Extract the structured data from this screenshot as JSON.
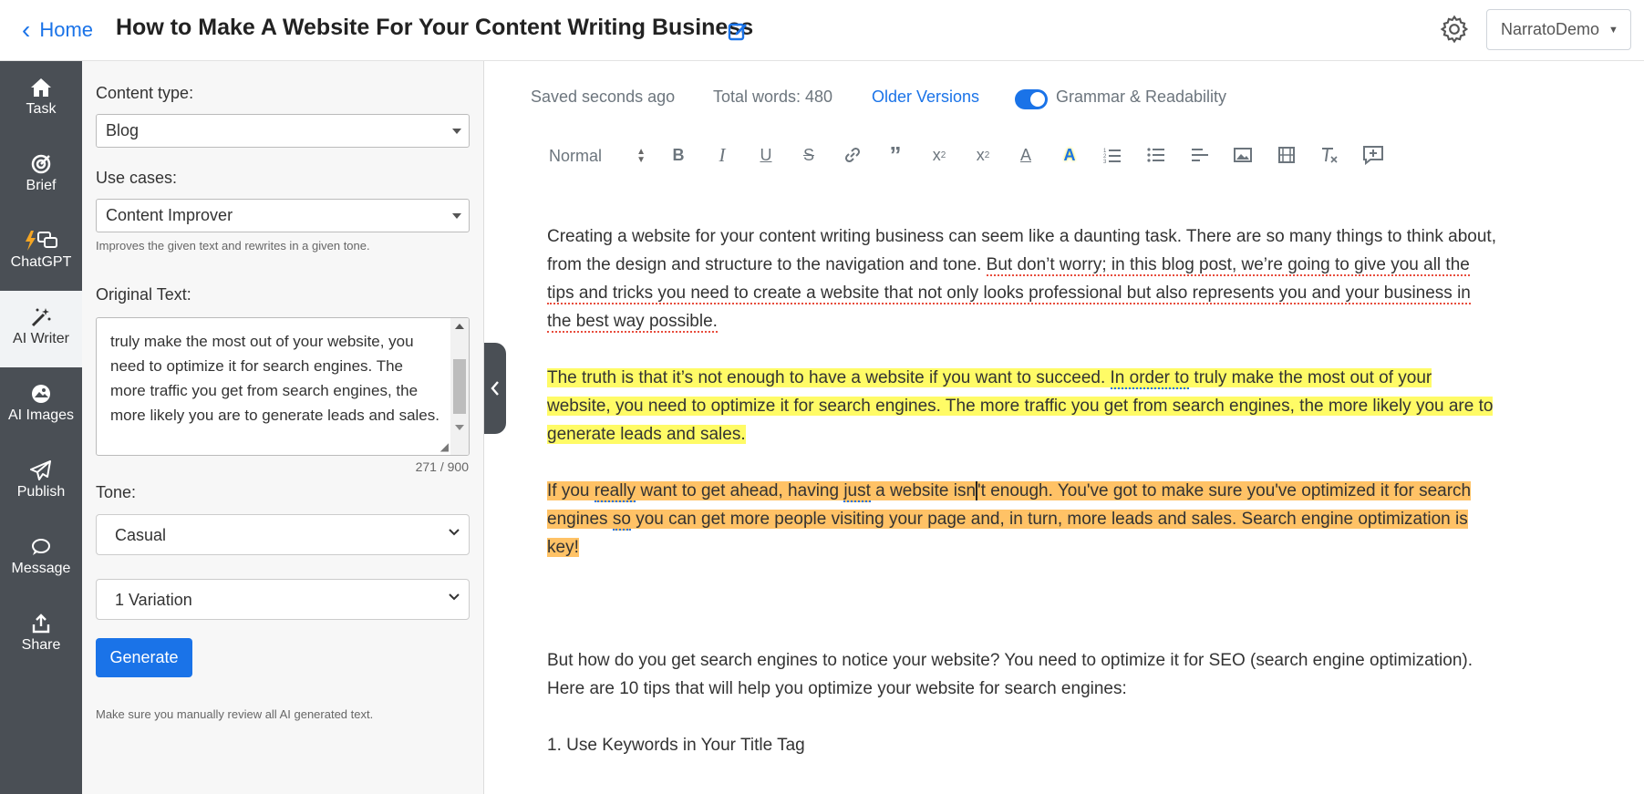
{
  "header": {
    "back_label": "Home",
    "title": "How to Make A Website For Your Content Writing Business",
    "user_menu": "NarratoDemo"
  },
  "rail": {
    "items": [
      {
        "label": "Task",
        "icon": "home-icon"
      },
      {
        "label": "Brief",
        "icon": "target-icon"
      },
      {
        "label": "ChatGPT",
        "icon": "chat-bolt-icon"
      },
      {
        "label": "AI Writer",
        "icon": "magic-wand-icon"
      },
      {
        "label": "AI Images",
        "icon": "image-icon"
      },
      {
        "label": "Publish",
        "icon": "send-icon"
      },
      {
        "label": "Message",
        "icon": "message-icon"
      },
      {
        "label": "Share",
        "icon": "share-icon"
      }
    ],
    "active": "AI Writer"
  },
  "panel": {
    "content_type_label": "Content type:",
    "content_type_value": "Blog",
    "use_cases_label": "Use cases:",
    "use_case_value": "Content Improver",
    "use_case_hint": "Improves the given text and rewrites in a given tone.",
    "original_text_label": "Original Text:",
    "original_text": "truly make the most out of your website, you need to optimize it for search engines. The more traffic you get from search engines, the more likely you are to generate leads and sales.",
    "char_count": "271 / 900",
    "tone_label": "Tone:",
    "tone_value": "Casual",
    "variation_value": "1 Variation",
    "generate_label": "Generate",
    "disclaimer": "Make sure you manually review all AI generated text."
  },
  "editor": {
    "saved_status": "Saved seconds ago",
    "word_count": "Total words: 480",
    "older_versions": "Older Versions",
    "grammar_toggle_label": "Grammar & Readability",
    "grammar_enabled": true,
    "format_select": "Normal",
    "toolbar_icons": [
      "bold-icon",
      "italic-icon",
      "underline-icon",
      "strikethrough-icon",
      "link-icon",
      "blockquote-icon",
      "subscript-icon",
      "superscript-icon",
      "text-color-icon",
      "highlight-icon",
      "ordered-list-icon",
      "bullet-list-icon",
      "align-icon",
      "image-icon",
      "video-icon",
      "clear-format-icon",
      "add-comment-icon"
    ],
    "p1_a": "Creating a website for your content writing business can seem like a daunting task. There are so many things to think about, from the design and structure to the navigation and tone. ",
    "p1_b": "But don’t worry; in this blog post, we’re going to give you all the tips and tricks you need to create a website that not only looks professional but also represents you and your business in the best way possible.",
    "p2_a": "The truth is that it’s not enough to have a website if you want to succeed. ",
    "p2_b": "In order to",
    "p2_c": " truly make the most out of your website, you need to optimize it for search engines. The more traffic you get from search engines, the more likely you are to generate leads and sales.",
    "p3_a": "If you ",
    "p3_b": "really",
    "p3_c": " want to get ahead, having ",
    "p3_d": "just",
    "p3_e": " a website isn",
    "p3_f": "'t enough. You've got to make sure you've optimized it for search engines ",
    "p3_g": "so",
    "p3_h": " you can get more people visiting your page and, in turn, more leads and sales. Search engine optimization is key!",
    "p4": "But how do you get search engines to notice your website? You need to optimize it for SEO (search engine optimization). Here are 10 tips that will help you optimize your website for search engines:",
    "p5": "1. Use Keywords in Your Title Tag"
  },
  "colors": {
    "accent": "#1a73e8",
    "rail_bg": "#4a4f55",
    "highlight_yellow": "#fffb66",
    "highlight_orange": "#ffc266"
  }
}
